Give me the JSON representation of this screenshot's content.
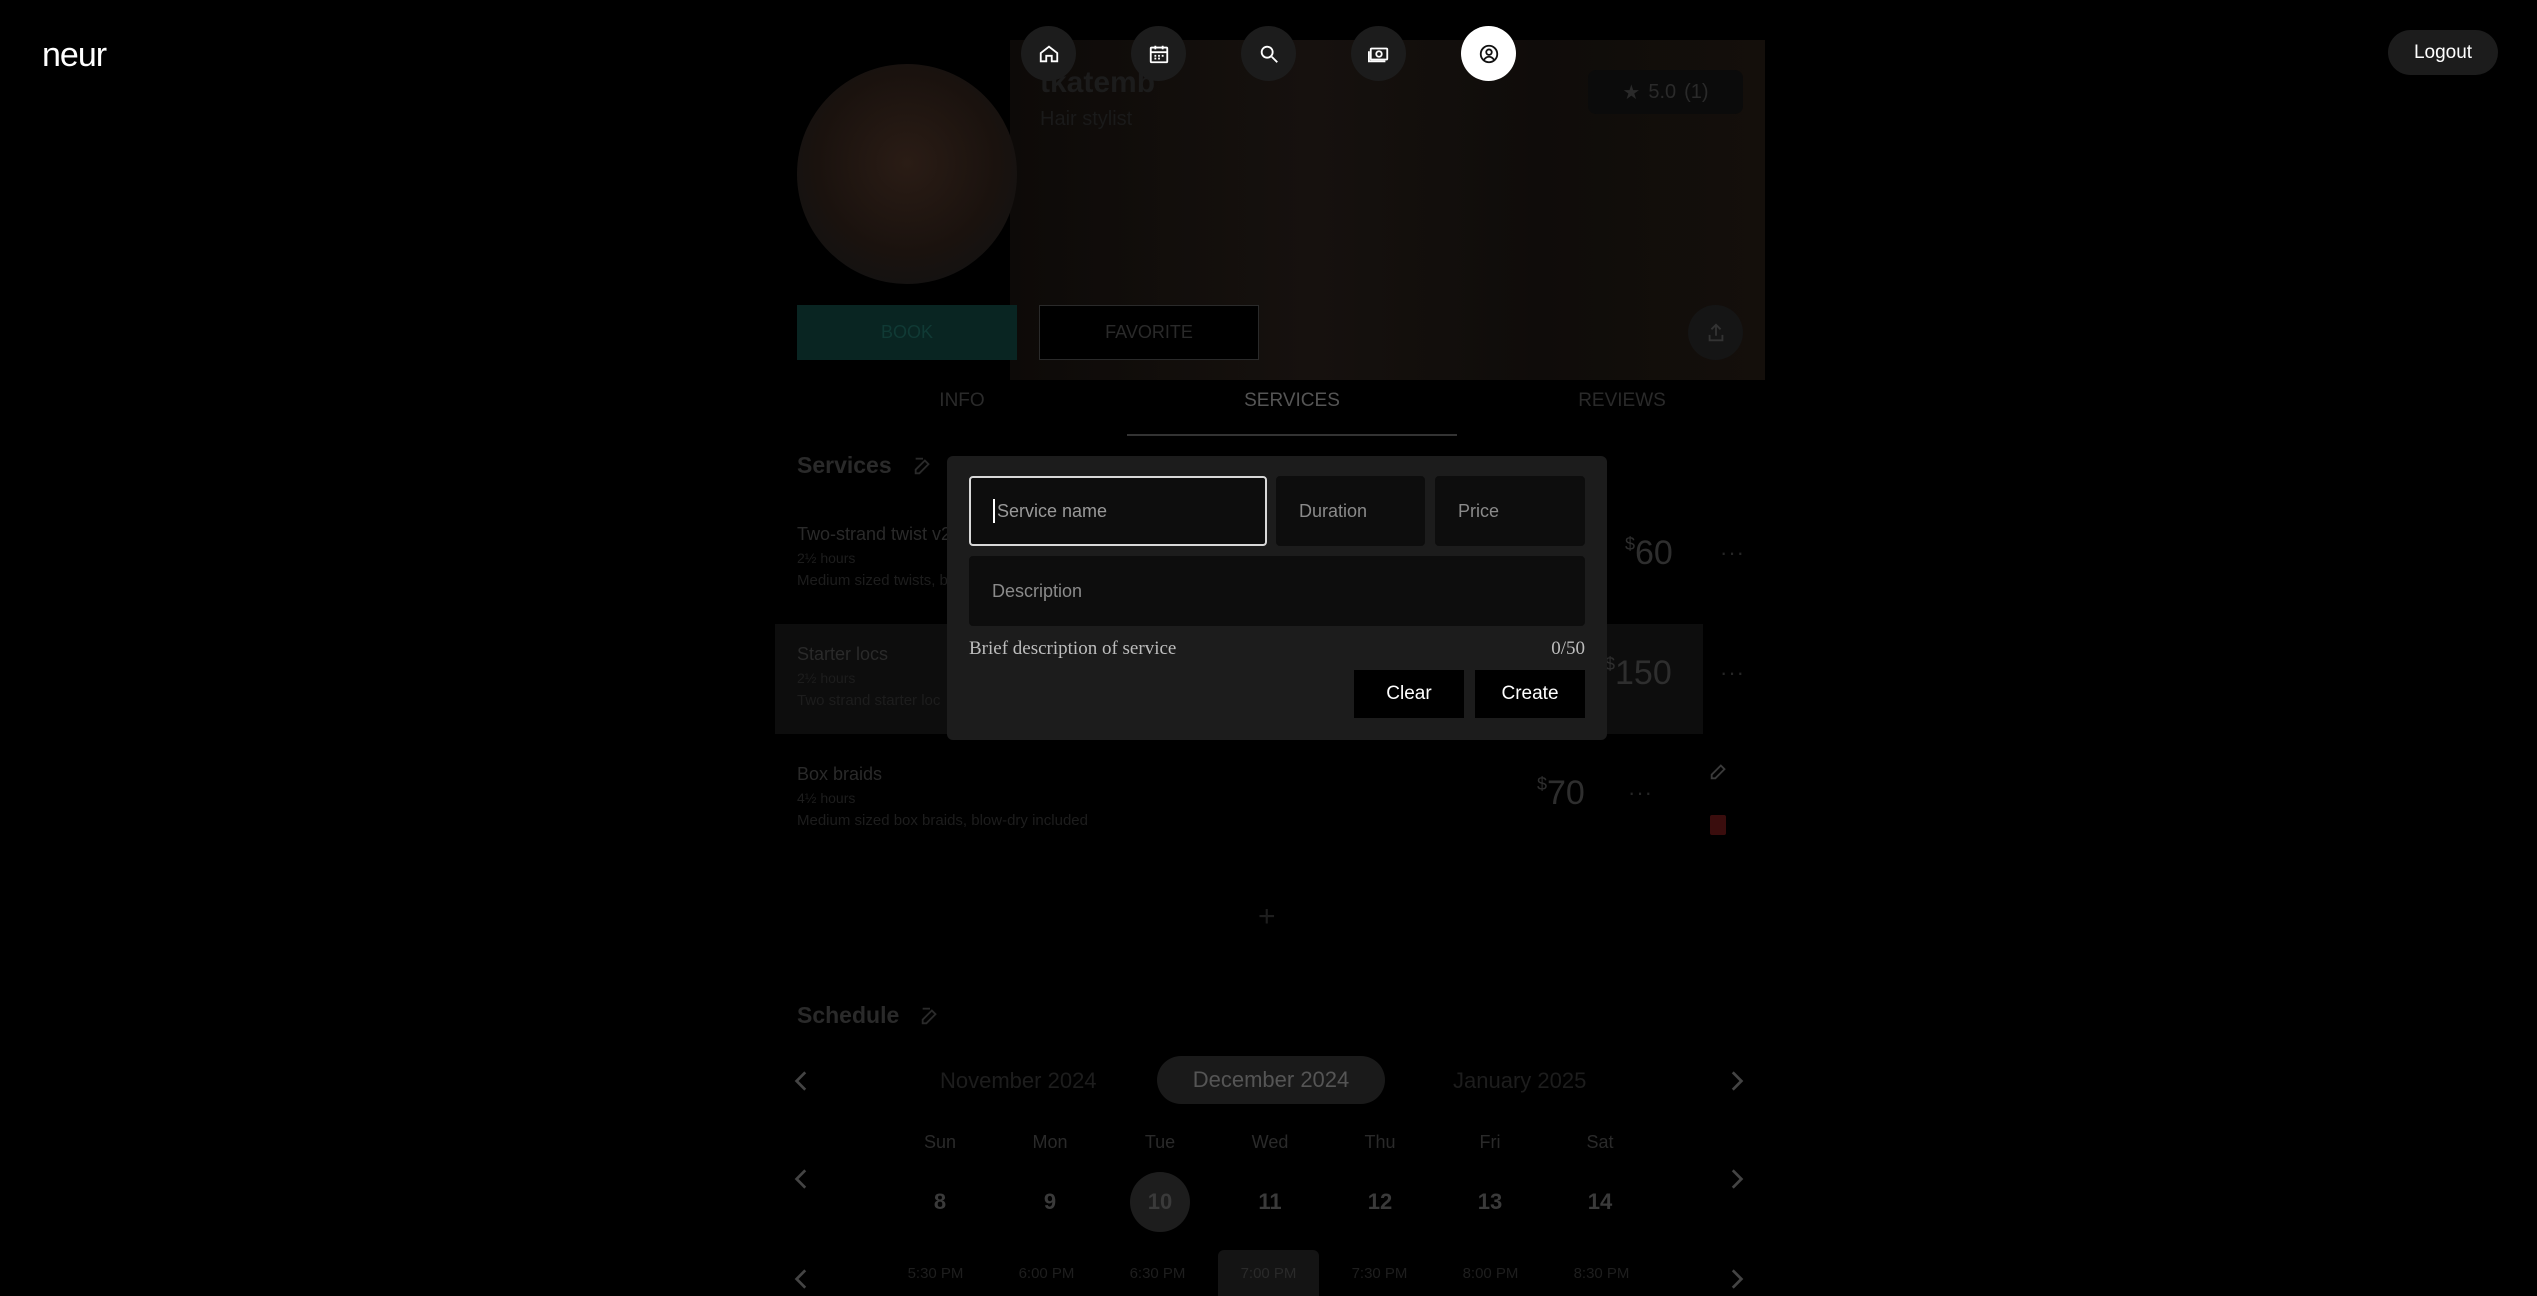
{
  "app": {
    "logo": "neur",
    "logout_label": "Logout"
  },
  "nav": [
    {
      "icon": "home-icon"
    },
    {
      "icon": "calendar-icon"
    },
    {
      "icon": "search-icon"
    },
    {
      "icon": "money-icon"
    },
    {
      "icon": "profile-icon",
      "active": true
    }
  ],
  "profile": {
    "name": "tkatemb",
    "role": "Hair stylist",
    "rating": "5.0",
    "rating_count": "(1)",
    "book_label": "BOOK",
    "favorite_label": "FAVORITE"
  },
  "tabs": [
    {
      "label": "INFO"
    },
    {
      "label": "SERVICES",
      "active": true
    },
    {
      "label": "REVIEWS"
    }
  ],
  "services": {
    "heading": "Services",
    "items": [
      {
        "name": "Two-strand twist v2",
        "duration": "2½ hours",
        "description": "Medium sized twists, bl",
        "currency": "$",
        "price": "60"
      },
      {
        "name": "Starter locs",
        "duration": "2½ hours",
        "description": "Two strand starter loc",
        "currency": "$",
        "price": "150"
      },
      {
        "name": "Box braids",
        "duration": "4½ hours",
        "description": "Medium sized box braids, blow-dry included",
        "currency": "$",
        "price": "70"
      }
    ],
    "add_label": "+"
  },
  "schedule": {
    "heading": "Schedule",
    "prev_month": "November 2024",
    "current_month": "December 2024",
    "next_month": "January 2025",
    "day_names": [
      "Sun",
      "Mon",
      "Tue",
      "Wed",
      "Thu",
      "Fri",
      "Sat"
    ],
    "day_numbers": [
      "8",
      "9",
      "10",
      "11",
      "12",
      "13",
      "14"
    ],
    "selected_day": "10",
    "times": [
      "5:30 PM",
      "6:00 PM",
      "6:30 PM",
      "7:00 PM",
      "7:30 PM",
      "8:00 PM",
      "8:30 PM"
    ],
    "selected_time": "7:00 PM"
  },
  "modal": {
    "service_name_placeholder": "Service name",
    "duration_placeholder": "Duration",
    "price_placeholder": "Price",
    "description_placeholder": "Description",
    "helper": "Brief description of service",
    "counter": "0/50",
    "clear_label": "Clear",
    "create_label": "Create"
  },
  "colors": {
    "background": "#000000",
    "modal": "#1c1c1c",
    "field": "#0d0d0d",
    "active_nav": "#ffffff"
  }
}
